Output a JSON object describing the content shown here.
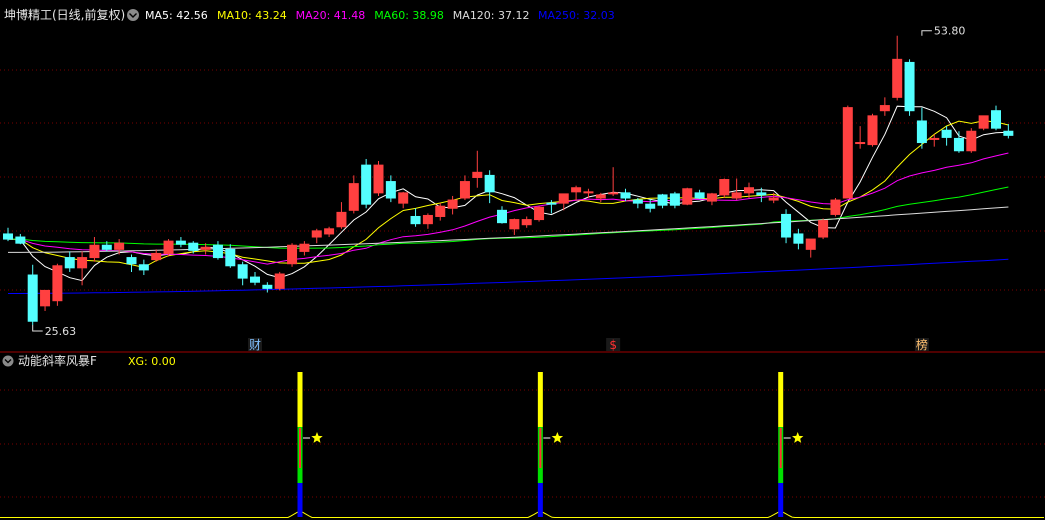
{
  "header": {
    "title": "坤博精工(日线,前复权)",
    "ma": [
      {
        "label": "MA5: 42.56",
        "color": "#ffffff"
      },
      {
        "label": "MA10: 43.24",
        "color": "#ffff00"
      },
      {
        "label": "MA20: 41.48",
        "color": "#ff00ff"
      },
      {
        "label": "MA60: 38.98",
        "color": "#00ff00"
      },
      {
        "label": "MA120: 37.12",
        "color": "#dcdcdc"
      },
      {
        "label": "MA250: 32.03",
        "color": "#0000ff"
      }
    ]
  },
  "sub_header": {
    "title": "动能斜率风暴F",
    "xg": "XG: 0.00"
  },
  "markers": [
    {
      "text": "财",
      "color": "#80c0ff",
      "index": 20
    },
    {
      "text": "$",
      "color": "#ff3030",
      "index": 49
    },
    {
      "text": "榜",
      "color": "#ffc070",
      "index": 74
    }
  ],
  "colors": {
    "up": "#ff4040",
    "down": "#54ffff",
    "grid": "#7a0000",
    "divider": "#a00000"
  },
  "chart_data": [
    {
      "type": "candlestick",
      "annotations": [
        {
          "text": "53.80",
          "index": 74,
          "value": 53.8
        },
        {
          "text": "25.63",
          "index": 2,
          "value": 25.63
        }
      ],
      "candles": [
        [
          34.5,
          35.1,
          33.8,
          34.0
        ],
        [
          34.2,
          34.5,
          33.5,
          33.6
        ],
        [
          30.5,
          31.5,
          25.63,
          26.0
        ],
        [
          27.5,
          29.0,
          27.0,
          29.0
        ],
        [
          28.0,
          31.6,
          27.5,
          31.4
        ],
        [
          32.2,
          32.8,
          30.8,
          31.2
        ],
        [
          31.2,
          32.8,
          29.5,
          32.2
        ],
        [
          32.2,
          34.2,
          31.8,
          33.4
        ],
        [
          33.4,
          33.8,
          32.8,
          33.0
        ],
        [
          33.0,
          34.0,
          32.5,
          33.6
        ],
        [
          32.2,
          32.5,
          30.8,
          31.6
        ],
        [
          31.5,
          32.0,
          30.5,
          31.0
        ],
        [
          32.0,
          33.0,
          31.8,
          32.6
        ],
        [
          32.6,
          34.0,
          32.3,
          33.8
        ],
        [
          33.8,
          34.2,
          33.2,
          33.5
        ],
        [
          33.6,
          33.8,
          32.6,
          32.9
        ],
        [
          33.0,
          33.6,
          32.5,
          33.2
        ],
        [
          33.4,
          33.8,
          32.0,
          32.2
        ],
        [
          33.0,
          33.5,
          31.2,
          31.4
        ],
        [
          31.5,
          31.8,
          29.5,
          30.2
        ],
        [
          30.3,
          30.8,
          29.5,
          29.8
        ],
        [
          29.5,
          29.8,
          28.8,
          29.2
        ],
        [
          29.2,
          30.8,
          29.0,
          30.6
        ],
        [
          31.6,
          33.6,
          31.3,
          33.4
        ],
        [
          32.8,
          33.8,
          32.4,
          33.5
        ],
        [
          34.2,
          35.0,
          33.6,
          34.8
        ],
        [
          34.5,
          35.2,
          34.2,
          35.0
        ],
        [
          35.2,
          37.6,
          35.0,
          36.6
        ],
        [
          36.8,
          40.2,
          36.5,
          39.4
        ],
        [
          41.2,
          41.8,
          37.0,
          37.4
        ],
        [
          38.5,
          41.6,
          38.2,
          41.2
        ],
        [
          39.6,
          40.2,
          37.6,
          38.0
        ],
        [
          37.5,
          38.6,
          37.0,
          38.5
        ],
        [
          36.2,
          37.0,
          35.2,
          35.5
        ],
        [
          35.5,
          36.5,
          35.0,
          36.3
        ],
        [
          36.2,
          37.5,
          35.8,
          37.2
        ],
        [
          37.0,
          38.2,
          36.4,
          37.8
        ],
        [
          38.0,
          40.2,
          37.8,
          39.6
        ],
        [
          40.0,
          42.6,
          39.0,
          40.5
        ],
        [
          40.2,
          40.7,
          37.5,
          38.6
        ],
        [
          36.8,
          37.2,
          35.5,
          35.6
        ],
        [
          35.0,
          36.0,
          34.4,
          35.9
        ],
        [
          35.4,
          36.2,
          35.1,
          35.9
        ],
        [
          35.9,
          37.2,
          35.7,
          37.1
        ],
        [
          37.5,
          37.8,
          36.5,
          37.4
        ],
        [
          37.5,
          38.2,
          36.8,
          38.4
        ],
        [
          38.6,
          39.2,
          37.8,
          39.0
        ],
        [
          38.5,
          38.9,
          38.0,
          38.6
        ],
        [
          38.0,
          38.5,
          37.6,
          38.3
        ],
        [
          38.5,
          41.0,
          38.2,
          38.5
        ],
        [
          38.5,
          38.9,
          37.7,
          38.0
        ],
        [
          37.8,
          38.0,
          37.0,
          37.5
        ],
        [
          37.4,
          37.9,
          36.6,
          37.0
        ],
        [
          38.3,
          38.4,
          37.0,
          37.3
        ],
        [
          38.4,
          38.6,
          37.0,
          37.3
        ],
        [
          37.4,
          39.0,
          37.3,
          38.9
        ],
        [
          38.5,
          38.8,
          37.9,
          38.0
        ],
        [
          37.7,
          38.5,
          37.3,
          38.4
        ],
        [
          38.3,
          39.9,
          38.0,
          39.8
        ],
        [
          38.0,
          39.9,
          37.8,
          38.5
        ],
        [
          38.5,
          39.5,
          38.0,
          39.0
        ],
        [
          38.5,
          39.0,
          37.6,
          38.3
        ],
        [
          37.8,
          38.5,
          37.5,
          38.0
        ],
        [
          36.4,
          36.9,
          33.6,
          34.2
        ],
        [
          34.5,
          35.0,
          33.0,
          33.6
        ],
        [
          33.0,
          34.0,
          32.2,
          34.0
        ],
        [
          34.2,
          36.0,
          34.0,
          35.8
        ],
        [
          36.4,
          38.0,
          36.2,
          37.8
        ],
        [
          38.0,
          47.0,
          38.0,
          46.8
        ],
        [
          43.4,
          45.0,
          42.8,
          43.4
        ],
        [
          43.2,
          46.2,
          43.0,
          46.0
        ],
        [
          46.5,
          47.8,
          46.0,
          47.0
        ],
        [
          47.8,
          53.8,
          47.5,
          51.5
        ],
        [
          51.2,
          51.5,
          46.0,
          46.5
        ],
        [
          45.5,
          46.8,
          42.8,
          43.4
        ],
        [
          43.8,
          44.2,
          43.0,
          43.8
        ],
        [
          44.6,
          45.0,
          43.1,
          43.9
        ],
        [
          43.8,
          44.5,
          42.4,
          42.6
        ],
        [
          42.6,
          44.8,
          42.4,
          44.5
        ],
        [
          44.8,
          46.0,
          44.6,
          46.0
        ],
        [
          46.5,
          47.0,
          44.6,
          44.8
        ],
        [
          44.5,
          45.2,
          43.8,
          44.1
        ]
      ],
      "ylim": [
        23.2,
        56.5
      ]
    },
    {
      "type": "signal_bars",
      "signals": [
        {
          "index": 21
        },
        {
          "index": 40
        },
        {
          "index": 59
        }
      ],
      "signal_value": 0.0
    }
  ]
}
